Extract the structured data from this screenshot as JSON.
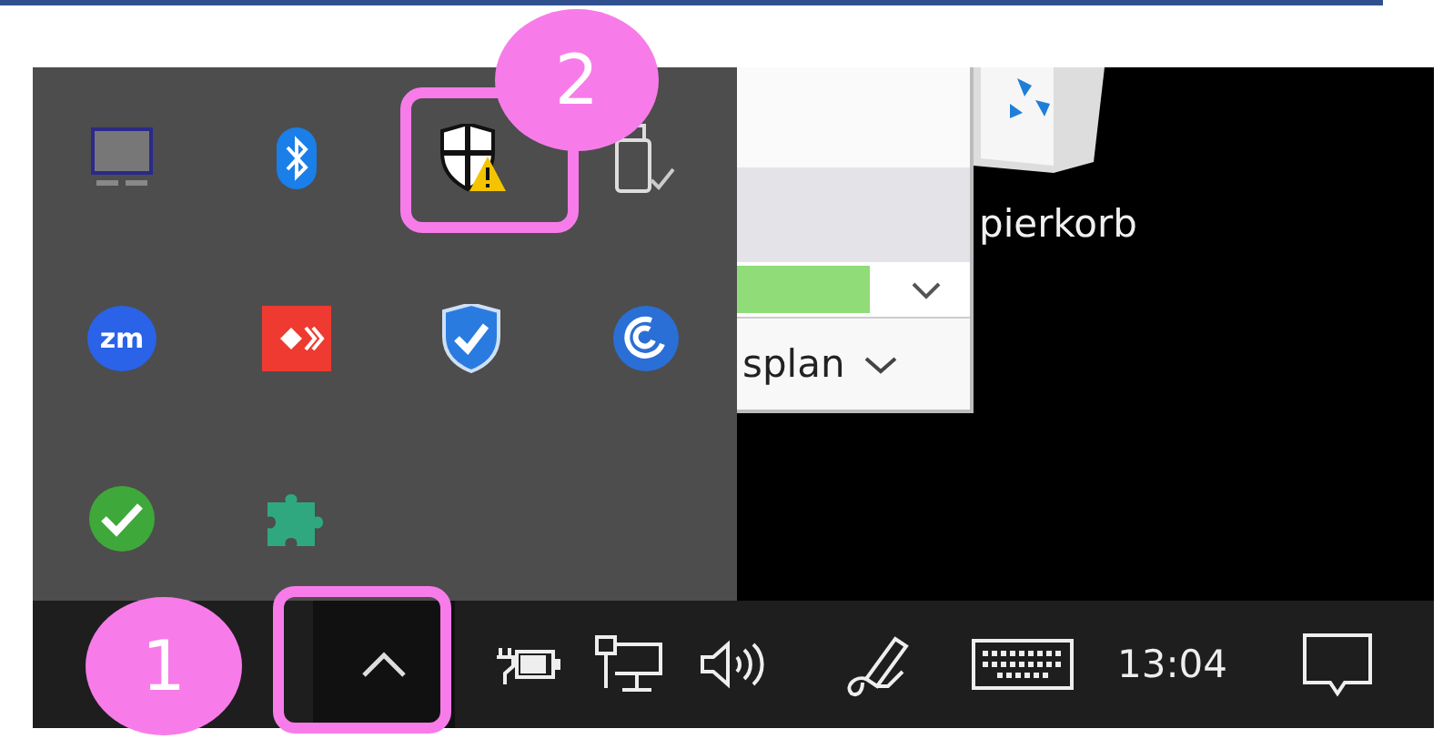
{
  "tray_overflow": {
    "icons": [
      {
        "kind": "laptop"
      },
      {
        "kind": "bluetooth"
      },
      {
        "kind": "shield-warning"
      },
      {
        "kind": "usb"
      },
      {
        "kind": "zoom",
        "text": "zm"
      },
      {
        "kind": "remote"
      },
      {
        "kind": "shield-check"
      },
      {
        "kind": "ring"
      },
      {
        "kind": "check"
      },
      {
        "kind": "puzzle"
      }
    ]
  },
  "window_fragment": {
    "dropdown_text": "splan"
  },
  "desktop": {
    "icon_label": "pierkorb"
  },
  "taskbar": {
    "items": [
      {
        "kind": "chevron"
      },
      {
        "kind": "power"
      },
      {
        "kind": "network"
      },
      {
        "kind": "volume"
      },
      {
        "kind": "pen"
      },
      {
        "kind": "keyboard"
      },
      {
        "kind": "clock",
        "text": "13:04"
      },
      {
        "kind": "notifications"
      }
    ]
  },
  "callouts": [
    {
      "number": "1",
      "kind": "taskbar"
    },
    {
      "number": "2",
      "kind": "tray"
    }
  ]
}
